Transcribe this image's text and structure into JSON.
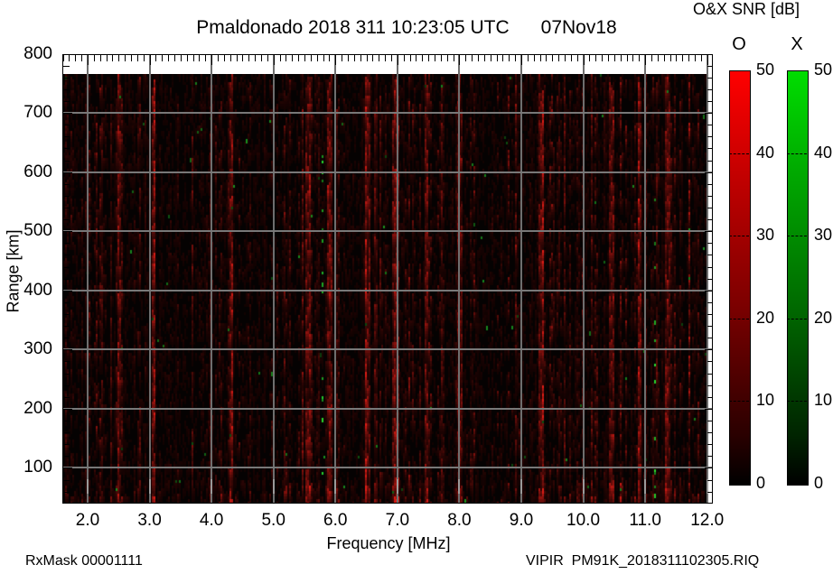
{
  "title": "Pmaldonado 2018 311 10:23:05 UTC      07Nov18",
  "colorbar_title": "O&X SNR [dB]",
  "footer": {
    "left": "RxMask 00001111",
    "right": "VIPIR  PM91K_2018311102305.RIQ"
  },
  "chart_data": {
    "type": "heatmap",
    "title": "Pmaldonado 2018 311 10:23:05 UTC 07Nov18",
    "subtitle": "O&X SNR [dB]",
    "xlabel": "Frequency [MHz]",
    "ylabel": "Range [km]",
    "xlim": [
      1.6,
      12.08
    ],
    "ylim": [
      40,
      800
    ],
    "x_ticks": [
      2.0,
      3.0,
      4.0,
      5.0,
      6.0,
      7.0,
      8.0,
      9.0,
      10.0,
      11.0,
      12.0
    ],
    "x_tick_labels": [
      "2.0",
      "3.0",
      "4.0",
      "5.0",
      "6.0",
      "7.0",
      "8.0",
      "9.0",
      "10.0",
      "11.0",
      "12.0"
    ],
    "x_minor_step_mhz": 0.1,
    "y_ticks": [
      100,
      200,
      300,
      400,
      500,
      600,
      700,
      800
    ],
    "y_minor_step_km": 20,
    "grid": true,
    "legend_position": "right",
    "colorbars": [
      {
        "label": "O",
        "color": "#ff0000",
        "min": 0,
        "max": 50,
        "ticks": [
          0,
          10,
          20,
          30,
          40,
          50
        ],
        "unit": "dB"
      },
      {
        "label": "X",
        "color": "#00dd00",
        "min": 0,
        "max": 50,
        "ticks": [
          0,
          10,
          20,
          30,
          40,
          50
        ],
        "unit": "dB"
      }
    ],
    "data_extent": {
      "freq_mhz": [
        1.6,
        12.0
      ],
      "range_km": [
        50,
        765
      ]
    },
    "content": "No ionospheric echo trace visible; field is low-level noise: dark-red vertical interference streaks over black background with sparse green X-mode specks",
    "noise": {
      "seed": 20181311,
      "background": "#050202",
      "red_color_max": "#e02020",
      "green_color_max": "#30d040",
      "red_hot_columns_mhz": [
        2.5,
        3.05,
        4.3,
        5.55,
        5.9,
        6.5,
        6.95,
        7.45,
        8.0,
        9.3,
        10.45,
        10.9,
        11.35
      ],
      "green_hot_columns_mhz": [
        5.78,
        11.15
      ]
    }
  }
}
